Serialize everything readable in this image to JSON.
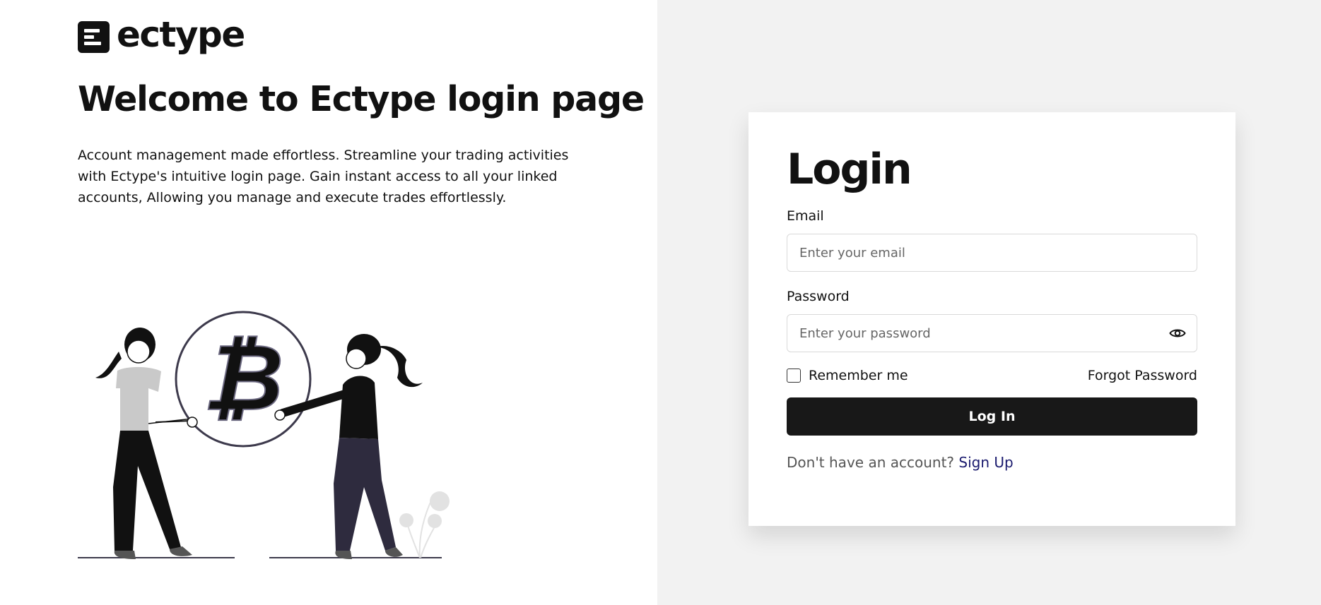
{
  "brand": {
    "name": "ectype"
  },
  "welcome": {
    "title": "Welcome to Ectype login page",
    "description": "Account management made effortless. Streamline your trading activities with Ectype's intuitive login page. Gain instant access to all your linked accounts, Allowing you manage and execute trades effortlessly."
  },
  "login": {
    "title": "Login",
    "email_label": "Email",
    "email_placeholder": "Enter your email",
    "email_value": "",
    "password_label": "Password",
    "password_placeholder": "Enter your password",
    "password_value": "",
    "password_toggle_icon": "eye-icon",
    "remember_label": "Remember me",
    "remember_checked": false,
    "forgot_label": "Forgot Password",
    "submit_label": "Log In",
    "signup_prompt": "Don't have an account?",
    "signup_link": "Sign Up"
  },
  "colors": {
    "left_bg": "#ffffff",
    "right_bg": "#f2f2f2",
    "button_bg": "#181818",
    "link": "#1a1a6e"
  }
}
